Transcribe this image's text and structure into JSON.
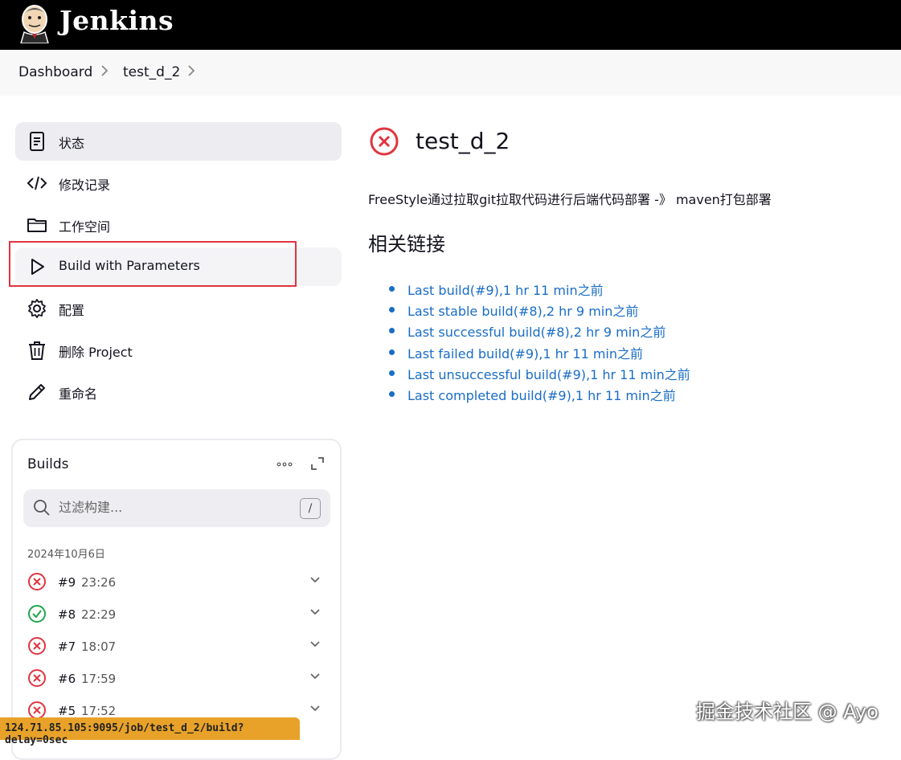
{
  "header": {
    "brand": "Jenkins",
    "logo": "jenkins-butler-logo"
  },
  "breadcrumb": {
    "items": [
      "Dashboard",
      "test_d_2"
    ]
  },
  "sidebar": {
    "items": [
      {
        "label": "状态",
        "icon": "notepad-icon"
      },
      {
        "label": "修改记录",
        "icon": "code-icon"
      },
      {
        "label": "工作空间",
        "icon": "folder-icon"
      },
      {
        "label": "Build with Parameters",
        "icon": "play-icon"
      },
      {
        "label": "配置",
        "icon": "gear-icon"
      },
      {
        "label": "删除 Project",
        "icon": "trash-icon"
      },
      {
        "label": "重命名",
        "icon": "pencil-icon"
      }
    ]
  },
  "builds": {
    "title": "Builds",
    "filter_placeholder": "过滤构建...",
    "shortcut_key": "/",
    "date": "2024年10月6日",
    "rows": [
      {
        "number": "#9",
        "time": "23:26",
        "status": "failed"
      },
      {
        "number": "#8",
        "time": "22:29",
        "status": "success"
      },
      {
        "number": "#7",
        "time": "18:07",
        "status": "failed"
      },
      {
        "number": "#6",
        "time": "17:59",
        "status": "failed"
      },
      {
        "number": "#5",
        "time": "17:52",
        "status": "failed"
      }
    ]
  },
  "main": {
    "title": "test_d_2",
    "status": "failed",
    "description": "FreeStyle通过拉取git拉取代码进行后端代码部署 -》 maven打包部署",
    "links_title": "相关链接",
    "links": [
      "Last build(#9),1 hr 11 min之前",
      "Last stable build(#8),2 hr 9 min之前",
      "Last successful build(#8),2 hr 9 min之前",
      "Last failed build(#9),1 hr 11 min之前",
      "Last unsuccessful build(#9),1 hr 11 min之前",
      "Last completed build(#9),1 hr 11 min之前"
    ]
  },
  "statusbar": {
    "url": "124.71.85.105:9095/job/test_d_2/build?delay=0sec"
  },
  "watermark": "掘金技术社区 @ Ayo",
  "colors": {
    "fail": "#e0353f",
    "success": "#1ea64b",
    "link": "#1a6dc6",
    "highlight": "#e0353f",
    "statusbar": "#e8a229"
  }
}
